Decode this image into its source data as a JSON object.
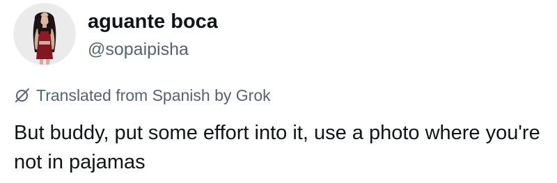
{
  "tweet": {
    "author": {
      "display_name": "aguante boca",
      "handle": "@sopaipisha",
      "avatar_icon": "profile-photo"
    },
    "translation": {
      "icon": "grok-icon",
      "label": "Translated from Spanish by Grok"
    },
    "text": "But buddy, put some effort into it, use a photo where you're not in pajamas"
  },
  "colors": {
    "primary_text": "#0f1419",
    "secondary_text": "#536471",
    "background": "#ffffff"
  }
}
